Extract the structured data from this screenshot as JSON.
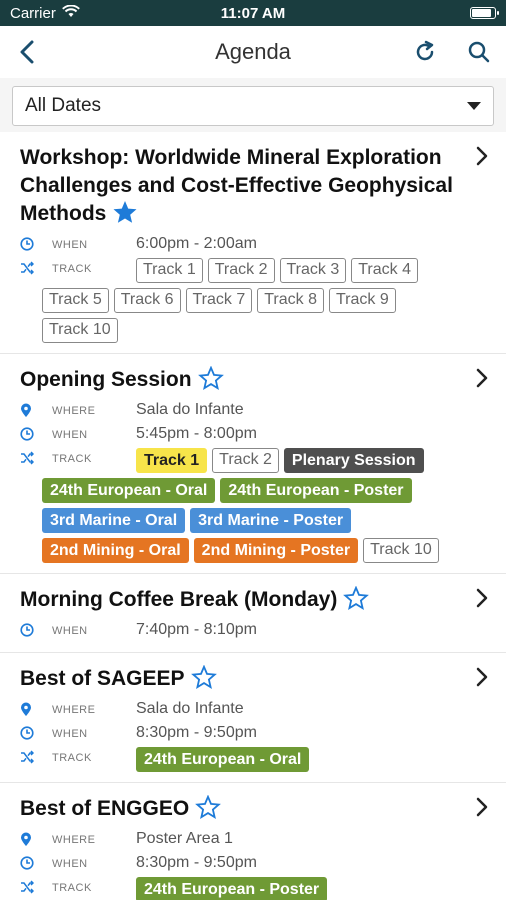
{
  "status": {
    "carrier": "Carrier",
    "time": "11:07 AM"
  },
  "nav": {
    "title": "Agenda"
  },
  "filter": {
    "selected": "All Dates"
  },
  "labels": {
    "where": "WHERE",
    "when": "WHEN",
    "track": "TRACK"
  },
  "colors": {
    "accent": "#1e7bd8",
    "statusbar": "#1a3d3f"
  },
  "sessions": [
    {
      "title": "Workshop: Worldwide Mineral Exploration Challenges and Cost-Effective Geophysical Methods",
      "favorite": true,
      "when": "6:00pm - 2:00am",
      "tracks": [
        "Track 1",
        "Track 2",
        "Track 3",
        "Track 4",
        "Track 5",
        "Track 6",
        "Track 7",
        "Track 8",
        "Track 9",
        "Track 10"
      ]
    },
    {
      "title": "Opening Session",
      "favorite": false,
      "where": "Sala do Infante",
      "when": "5:45pm - 8:00pm",
      "tracks": [
        "Track 1",
        "Track 2",
        "Plenary Session",
        "24th European - Oral",
        "24th European - Poster",
        "3rd Marine - Oral",
        "3rd Marine - Poster",
        "2nd Mining - Oral",
        "2nd Mining - Poster",
        "Track 10"
      ]
    },
    {
      "title": "Morning Coffee Break (Monday)",
      "favorite": false,
      "when": "7:40pm - 8:10pm"
    },
    {
      "title": "Best of SAGEEP",
      "favorite": false,
      "where": "Sala do Infante",
      "when": "8:30pm - 9:50pm",
      "tracks": [
        "24th European - Oral"
      ]
    },
    {
      "title": "Best of ENGGEO",
      "favorite": false,
      "where": "Poster Area 1",
      "when": "8:30pm - 9:50pm",
      "tracks": [
        "24th European - Poster"
      ]
    }
  ]
}
